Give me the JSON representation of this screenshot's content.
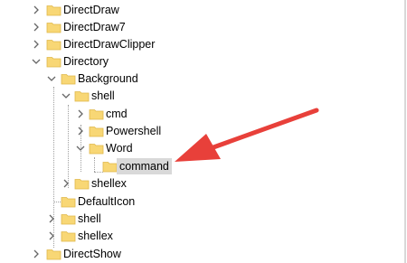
{
  "tree": {
    "items": [
      {
        "label": "DirectDraw",
        "state": "collapsed"
      },
      {
        "label": "DirectDraw7",
        "state": "collapsed"
      },
      {
        "label": "DirectDrawClipper",
        "state": "collapsed"
      },
      {
        "label": "Directory",
        "state": "expanded"
      },
      {
        "label": "Background",
        "state": "expanded"
      },
      {
        "label": "shell",
        "state": "expanded"
      },
      {
        "label": "cmd",
        "state": "collapsed"
      },
      {
        "label": "Powershell",
        "state": "collapsed"
      },
      {
        "label": "Word",
        "state": "expanded"
      },
      {
        "label": "command",
        "state": "selected"
      },
      {
        "label": "shellex",
        "state": "collapsed"
      },
      {
        "label": "DefaultIcon",
        "state": "leaf"
      },
      {
        "label": "shell",
        "state": "collapsed"
      },
      {
        "label": "shellex",
        "state": "collapsed"
      },
      {
        "label": "DirectShow",
        "state": "collapsed"
      }
    ]
  },
  "colors": {
    "folder_fill": "#f8d775",
    "folder_edge": "#e0b84a",
    "chevron": "#666666",
    "selection": "#d9d9d9",
    "arrow": "#e8403a"
  },
  "icons": {
    "folder": "folder-icon",
    "collapsed": "chevron-right-icon",
    "expanded": "chevron-down-icon",
    "annotation": "red-arrow-annotation"
  }
}
